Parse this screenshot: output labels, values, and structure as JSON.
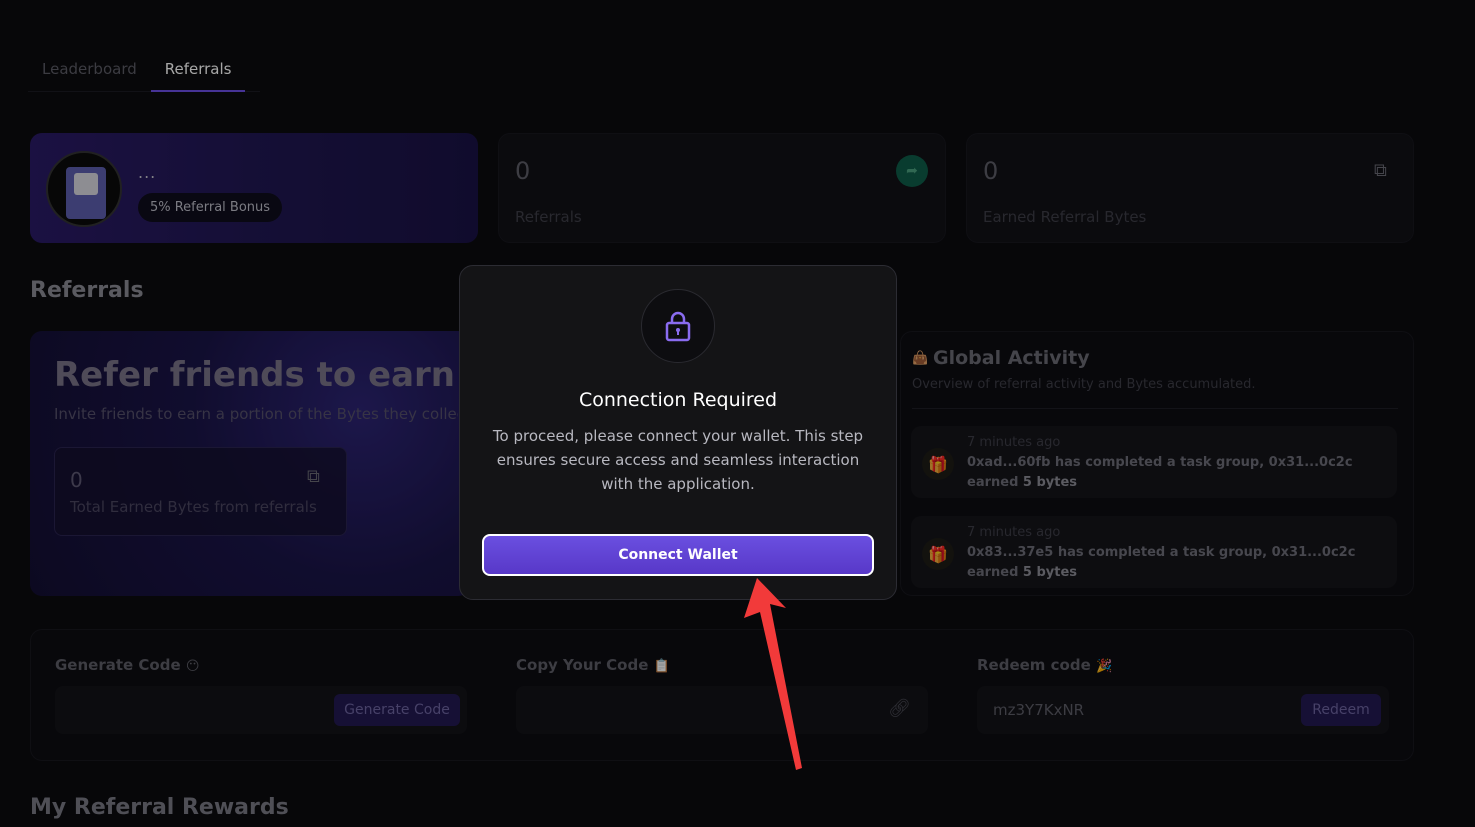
{
  "tabs": [
    {
      "label": "Leaderboard"
    },
    {
      "label": "Referrals"
    }
  ],
  "profile": {
    "name": "...",
    "bonus": "5% Referral Bonus"
  },
  "stats": [
    {
      "value": "0",
      "label": "Referrals",
      "icon": "share-icon"
    },
    {
      "value": "0",
      "label": "Earned Referral Bytes",
      "icon": "bytes-icon"
    }
  ],
  "referrals_section": {
    "title": "Referrals",
    "card_title": "Refer friends to earn Bytes",
    "card_subtitle": "Invite friends to earn a portion of the Bytes they collect",
    "total_value": "0",
    "total_label": "Total Earned Bytes from referrals"
  },
  "global_activity": {
    "title": "Global Activity",
    "subtitle": "Overview of referral activity and Bytes accumulated.",
    "items": [
      {
        "time": "7 minutes ago",
        "text": "0xad...60fb has completed a task group, 0x31...0c2c earned ",
        "amount": "5",
        "unit": "bytes"
      },
      {
        "time": "7 minutes ago",
        "text": "0x83...37e5 has completed a task group, 0x31...0c2c earned ",
        "amount": "5",
        "unit": "bytes"
      }
    ]
  },
  "codes": {
    "generate_label": "Generate Code",
    "generate_emoji": "😶",
    "generate_button": "Generate Code",
    "copy_label": "Copy Your Code",
    "copy_emoji": "📋",
    "redeem_label": "Redeem code",
    "redeem_emoji": "🎉",
    "redeem_value": "mz3Y7KxNR",
    "redeem_button": "Redeem"
  },
  "rewards_title": "My Referral Rewards",
  "modal": {
    "title": "Connection Required",
    "text": "To proceed, please connect your wallet. This step ensures secure access and seamless interaction with the application.",
    "button": "Connect Wallet"
  },
  "colors": {
    "accent": "#6a4fe0",
    "annotation_arrow": "#f23a3a"
  }
}
